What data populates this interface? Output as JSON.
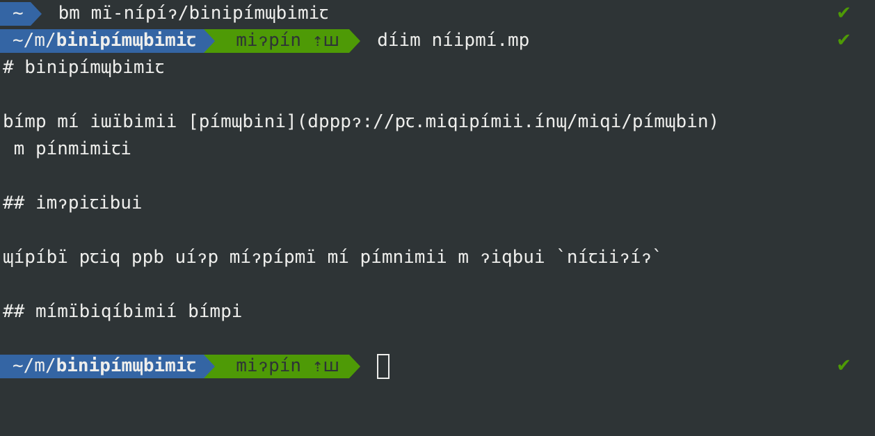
{
  "line1": {
    "home": "~",
    "command": "bm mï-nípíɂ/binipímɰbimiꞇ",
    "status": "✔"
  },
  "prompt": {
    "path_prefix": "~/m/",
    "path_bold": "binipímɰbimiꞇ",
    "git": "miɂpín ⇡ꟺ",
    "command": "díim níipmí.mp",
    "status": "✔"
  },
  "content": [
    "# binipímɰbimiꞇ",
    "",
    "bímp mí iɯïbimii [pímɰbini](dpppɂ://pꞇ.miqipímii.ínɰ/miqi/pímɰbin)",
    " m pínmimiꞇi",
    "",
    "## imɂpiꞇibui",
    "",
    "ɰípíbï pꞇiq ppb uíɂp míɂpípmï mí pímnimii m ɂiqbui `níꞇiiɂíɂ`",
    "",
    "## mímïbiqíbimií bímpi",
    ""
  ],
  "prompt2": {
    "path_prefix": "~/m/",
    "path_bold": "binipímɰbimiꞇ",
    "git": "miɂpín ⇡ꟺ",
    "status": "✔"
  },
  "icons": {
    "check": "check-icon",
    "powerline_separator": "powerline-arrow-icon"
  },
  "colors": {
    "background": "#2e3436",
    "foreground": "#eeeeec",
    "path_segment": "#3465a4",
    "git_segment": "#4e9a06",
    "success": "#4e9a06"
  }
}
